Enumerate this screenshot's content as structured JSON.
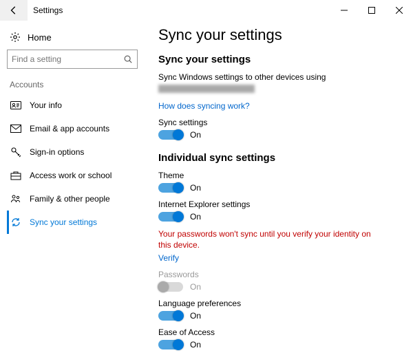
{
  "window": {
    "title": "Settings"
  },
  "sidebar": {
    "home_label": "Home",
    "search_placeholder": "Find a setting",
    "group_label": "Accounts",
    "items": [
      {
        "label": "Your info"
      },
      {
        "label": "Email & app accounts"
      },
      {
        "label": "Sign-in options"
      },
      {
        "label": "Access work or school"
      },
      {
        "label": "Family & other people"
      },
      {
        "label": "Sync your settings"
      }
    ]
  },
  "content": {
    "page_title": "Sync your settings",
    "section1_title": "Sync your settings",
    "section1_desc": "Sync Windows settings to other devices using",
    "help_link": "How does syncing work?",
    "sync_settings": {
      "label": "Sync settings",
      "state": "On"
    },
    "section2_title": "Individual sync settings",
    "theme": {
      "label": "Theme",
      "state": "On"
    },
    "ie": {
      "label": "Internet Explorer settings",
      "state": "On"
    },
    "warning": "Your passwords won't sync until you verify your identity on this device.",
    "verify_link": "Verify",
    "passwords": {
      "label": "Passwords",
      "state": "On"
    },
    "language": {
      "label": "Language preferences",
      "state": "On"
    },
    "ease": {
      "label": "Ease of Access",
      "state": "On"
    }
  }
}
